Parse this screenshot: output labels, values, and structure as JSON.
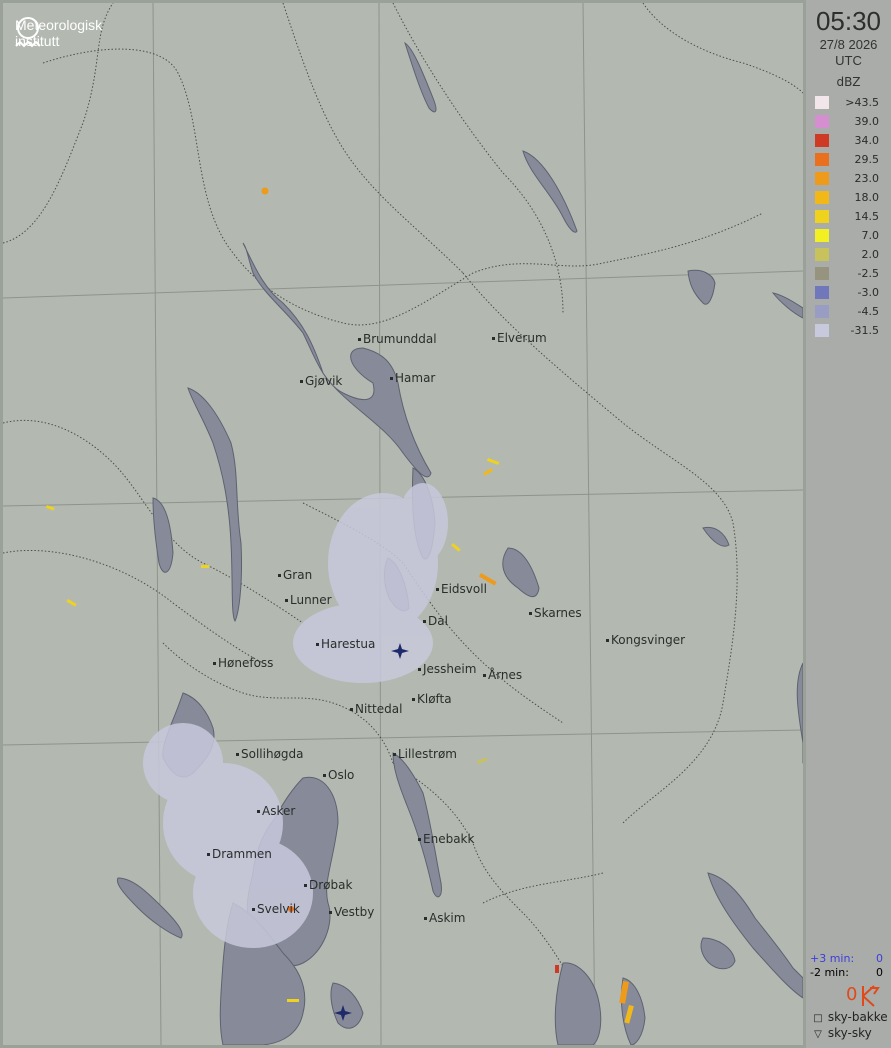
{
  "brand": {
    "line1": "Meteorologisk",
    "line2": "institutt"
  },
  "panel": {
    "time": "05:30",
    "date": "27/8 2026",
    "timezone": "UTC",
    "unit": "dBZ",
    "legend": [
      {
        "value": ">43.5",
        "color": "#f2e6ea"
      },
      {
        "value": "39.0",
        "color": "#d58ed0"
      },
      {
        "value": "34.0",
        "color": "#cf3a24"
      },
      {
        "value": "29.5",
        "color": "#e8701f"
      },
      {
        "value": "23.0",
        "color": "#ee9a1a"
      },
      {
        "value": "18.0",
        "color": "#f2b818"
      },
      {
        "value": "14.5",
        "color": "#efd21e"
      },
      {
        "value": "7.0",
        "color": "#f2ef22"
      },
      {
        "value": "2.0",
        "color": "#c8c25c"
      },
      {
        "value": "-2.5",
        "color": "#96947e"
      },
      {
        "value": "-3.0",
        "color": "#7177bb"
      },
      {
        "value": "-4.5",
        "color": "#9a9dc3"
      },
      {
        "value": "-31.5",
        "color": "#c8c9dc"
      }
    ],
    "strikes": {
      "plus_label": "+3 min:",
      "plus_value": "0",
      "plus_color": "#3d3de0",
      "minus_label": "-2 min:",
      "minus_value": "0",
      "total": "0",
      "total_color": "#e04a1a",
      "ground_label": "sky-bakke",
      "cloud_label": "sky-sky"
    }
  },
  "map": {
    "cities": [
      {
        "name": "Brumunddal"
      },
      {
        "name": "Elverum"
      },
      {
        "name": "Gjøvik"
      },
      {
        "name": "Hamar"
      },
      {
        "name": "Gran"
      },
      {
        "name": "Eidsvoll"
      },
      {
        "name": "Lunner"
      },
      {
        "name": "Dal"
      },
      {
        "name": "Skarnes"
      },
      {
        "name": "Harestua"
      },
      {
        "name": "Kongsvinger"
      },
      {
        "name": "Hønefoss"
      },
      {
        "name": "Jessheim"
      },
      {
        "name": "Årnes"
      },
      {
        "name": "Kløfta"
      },
      {
        "name": "Nittedal"
      },
      {
        "name": "Sollihøgda"
      },
      {
        "name": "Lillestrøm"
      },
      {
        "name": "Oslo"
      },
      {
        "name": "Asker"
      },
      {
        "name": "Enebakk"
      },
      {
        "name": "Drammen"
      },
      {
        "name": "Drøbak"
      },
      {
        "name": "Svelvik"
      },
      {
        "name": "Vestby"
      },
      {
        "name": "Askim"
      }
    ],
    "airports": [
      "Gardermoen",
      "Rygge"
    ]
  }
}
